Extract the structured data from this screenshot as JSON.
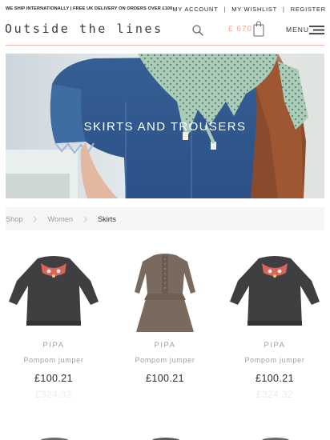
{
  "topbar": {
    "shipping_notice": "WE SHIP INTERNATIONALLY | FREE UK DELIVERY ON ORDERS OVER £100",
    "my_account": "MY ACCOUNT",
    "my_wishlist": "MY WISHLIST",
    "register": "REGISTER",
    "separator": "|"
  },
  "header": {
    "logo": "Outside the lines",
    "cart_amount": "£ 670",
    "menu_label": "MENU",
    "icons": [
      "search-icon",
      "shopping-bag-icon",
      "hamburger-icon"
    ],
    "accent_color": "#f0a78c"
  },
  "hero": {
    "title": "SKIRTS AND TROUSERS"
  },
  "breadcrumb": {
    "items": [
      "Shop",
      "Women",
      "Skirts"
    ]
  },
  "products": [
    {
      "brand": "PIPA",
      "name": "Pompom jumper",
      "price": "£100.21",
      "old_price": "£324.32",
      "image": "embroidered-jumper"
    },
    {
      "brand": "PIPA",
      "name": "Pompom jumper",
      "price": "£100.21",
      "old_price": "",
      "image": "smock-dress"
    },
    {
      "brand": "PIPA",
      "name": "Pompom jumper",
      "price": "£100.21",
      "old_price": "£324.32",
      "image": "embroidered-jumper"
    }
  ]
}
